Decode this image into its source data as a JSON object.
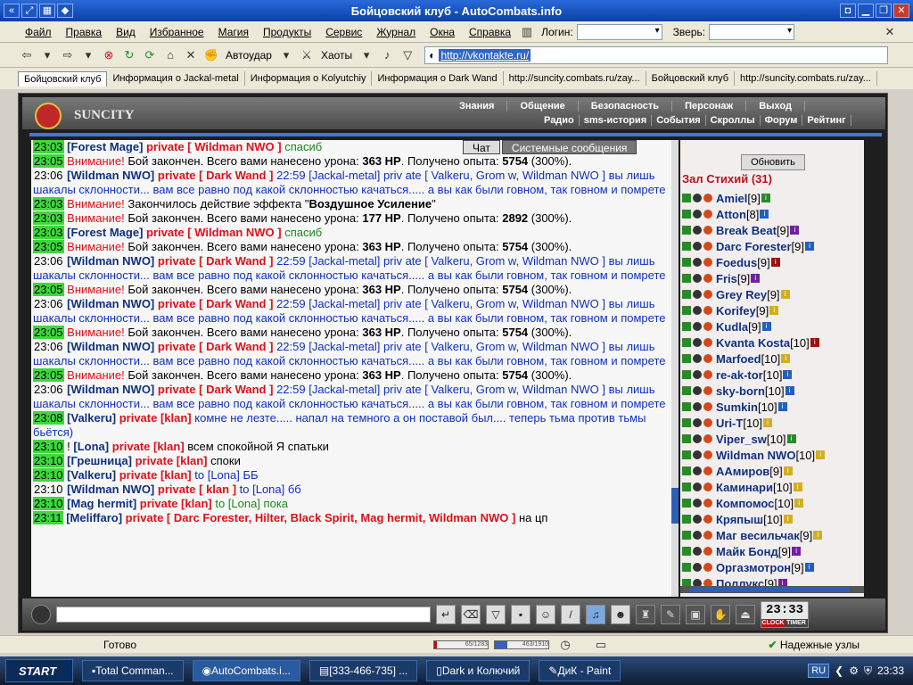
{
  "window": {
    "title": "Бойцовский клуб - AutoCombats.info"
  },
  "menu": {
    "items": [
      "Файл",
      "Правка",
      "Вид",
      "Избранное",
      "Магия",
      "Продукты",
      "Сервис",
      "Журнал",
      "Окна",
      "Справка"
    ],
    "login_label": "Логин:",
    "beast_label": "Зверь:"
  },
  "toolbar": {
    "autoudar": "Автоудар",
    "haoty": "Хаоты",
    "url": "http://vkontakte.ru/"
  },
  "tabs": [
    "Бойцовский клуб",
    "Информация о Jackal-metal",
    "Информация о Kolyutchiy",
    "Информация о Dark Wand",
    "http://suncity.combats.ru/zay...",
    "Бойцовский клуб",
    "http://suncity.combats.ru/zay..."
  ],
  "game": {
    "city": "SUNCITY",
    "nav": [
      "Знания",
      "Общение",
      "Безопасность",
      "Персонаж",
      "Выход"
    ],
    "subnav": [
      "Радио",
      "sms-история",
      "События",
      "Скроллы",
      "Форум",
      "Рейтинг"
    ],
    "chat_tabs": [
      "Чат",
      "Системные сообщения"
    ],
    "update_btn": "Обновить",
    "hall": "Зал Стихий (31)",
    "clock": "23:33",
    "clock_labels": [
      "CLOCK",
      "TIMER"
    ]
  },
  "chat": [
    {
      "t": "23:03",
      "name": "Forest Mage",
      "priv": "private [ Wildman NWO ]",
      "msg": "спасиб",
      "kind": "green"
    },
    {
      "t": "23:05",
      "warn": "Внимание!",
      "text": "Бой закончен. Всего вами нанесено урона: ",
      "b1": "363 HP",
      "text2": ". Получено опыта: ",
      "b2": "5754",
      "text3": " (300%)."
    },
    {
      "t": "23:06",
      "plain": true,
      "name": "Wildman NWO",
      "priv": "private [ Dark Wand ]",
      "msg": "22:59 [Jackal-metal] priv ate [ Valkeru, Grom w, Wildman NWO ] вы лишь шакалы склонности... вам все равно под какой склонностью качаться..... а вы как были говном, так говном и помрете",
      "kind": "blue"
    },
    {
      "t": "23:03",
      "warn": "Внимание!",
      "text": "Закончилось действие эффекта \"",
      "b1": "Воздушное Усиление",
      "text2": "\"",
      "b2": "",
      "text3": ""
    },
    {
      "t": "23:03",
      "warn": "Внимание!",
      "text": "Бой закончен. Всего вами нанесено урона: ",
      "b1": "177 HP",
      "text2": ". Получено опыта: ",
      "b2": "2892",
      "text3": " (300%)."
    },
    {
      "t": "23:03",
      "name": "Forest Mage",
      "priv": "private [ Wildman NWO ]",
      "msg": "спасиб",
      "kind": "green"
    },
    {
      "t": "23:05",
      "warn": "Внимание!",
      "text": "Бой закончен. Всего вами нанесено урона: ",
      "b1": "363 HP",
      "text2": ". Получено опыта: ",
      "b2": "5754",
      "text3": " (300%)."
    },
    {
      "t": "23:06",
      "plain": true,
      "name": "Wildman NWO",
      "priv": "private [ Dark Wand ]",
      "msg": "22:59 [Jackal-metal] priv ate [ Valkeru, Grom w, Wildman NWO ] вы лишь шакалы склонности... вам все равно под какой склонностью качаться..... а вы как были говном, так говном и помрете",
      "kind": "blue"
    },
    {
      "t": "23:05",
      "warn": "Внимание!",
      "text": "Бой закончен. Всего вами нанесено урона: ",
      "b1": "363 HP",
      "text2": ". Получено опыта: ",
      "b2": "5754",
      "text3": " (300%)."
    },
    {
      "t": "23:06",
      "plain": true,
      "name": "Wildman NWO",
      "priv": "private [ Dark Wand ]",
      "msg": "22:59 [Jackal-metal] priv ate [ Valkeru, Grom w, Wildman NWO ] вы лишь шакалы склонности... вам все равно под какой склонностью качаться..... а вы как были говном, так говном и помрете",
      "kind": "blue"
    },
    {
      "t": "23:05",
      "warn": "Внимание!",
      "text": "Бой закончен. Всего вами нанесено урона: ",
      "b1": "363 HP",
      "text2": ". Получено опыта: ",
      "b2": "5754",
      "text3": " (300%)."
    },
    {
      "t": "23:06",
      "plain": true,
      "name": "Wildman NWO",
      "priv": "private [ Dark Wand ]",
      "msg": "22:59 [Jackal-metal] priv ate [ Valkeru, Grom w, Wildman NWO ] вы лишь шакалы склонности... вам все равно под какой склонностью качаться..... а вы как были говном, так говном и помрете",
      "kind": "blue"
    },
    {
      "t": "23:05",
      "warn": "Внимание!",
      "text": "Бой закончен. Всего вами нанесено урона: ",
      "b1": "363 HP",
      "text2": ". Получено опыта: ",
      "b2": "5754",
      "text3": " (300%)."
    },
    {
      "t": "23:06",
      "plain": true,
      "name": "Wildman NWO",
      "priv": "private [ Dark Wand ]",
      "msg": "22:59 [Jackal-metal] priv ate [ Valkeru, Grom w, Wildman NWO ] вы лишь шакалы склонности... вам все равно под какой склонностью качаться..... а вы как были говном, так говном и помрете",
      "kind": "blue"
    },
    {
      "t": "23:08",
      "name": "Valkeru",
      "priv": "private [klan]",
      "msg": "комне не лезте..... напал на темного а он поставой был.... теперь тьма против тьмы бьётся)",
      "kind": "blue"
    },
    {
      "t": "23:10",
      "pre": "! ",
      "name": "Lona",
      "priv": "private [klan]",
      "msg": "всем спокойной Я спатьки",
      "kind": "black"
    },
    {
      "t": "23:10",
      "name": "Грешница",
      "priv": "private [klan]",
      "msg": "споки",
      "kind": "black"
    },
    {
      "t": "23:10",
      "name": "Valkeru",
      "priv": "private [klan]",
      "msg": "to [Lona] ББ",
      "kind": "blue"
    },
    {
      "t": "23:10",
      "plain": true,
      "name": "Wildman NWO",
      "priv": "private [ klan ]",
      "msg": "to [Lona] бб",
      "kind": "blue"
    },
    {
      "t": "23:10",
      "name": "Mag hermit",
      "priv": "private [klan]",
      "msg": "to [Lona] пока",
      "kind": "green"
    },
    {
      "t": "23:11",
      "name": "Meliffaro",
      "priv": "private [ Darc Forester, Hilter, Black Spirit, Mag hermit, Wildman NWO ]",
      "msg": "на цп",
      "kind": "black"
    }
  ],
  "users": [
    {
      "name": "Amiel",
      "lvl": "[9]",
      "info": "g"
    },
    {
      "name": "Atton",
      "lvl": "[8]",
      "info": "b"
    },
    {
      "name": "Break Beat",
      "lvl": "[9]",
      "info": "p"
    },
    {
      "name": "Darc Forester",
      "lvl": "[9]",
      "info": "b"
    },
    {
      "name": "Foedus",
      "lvl": "[9]",
      "info": "r"
    },
    {
      "name": "Fris",
      "lvl": "[9]",
      "info": "p"
    },
    {
      "name": "Grey Rey",
      "lvl": "[9]",
      "info": "y"
    },
    {
      "name": "Korifey",
      "lvl": "[9]",
      "info": "y"
    },
    {
      "name": "Kudla",
      "lvl": "[9]",
      "info": "b"
    },
    {
      "name": "Kvanta Kosta",
      "lvl": "[10]",
      "info": "r"
    },
    {
      "name": "Marfoed",
      "lvl": "[10]",
      "info": "y"
    },
    {
      "name": "re-ak-tor",
      "lvl": "[10]",
      "info": "b"
    },
    {
      "name": "sky-born",
      "lvl": "[10]",
      "info": "b"
    },
    {
      "name": "Sumkin",
      "lvl": "[10]",
      "info": "b"
    },
    {
      "name": "Uri-T",
      "lvl": "[10]",
      "info": "y"
    },
    {
      "name": "Viper_sw",
      "lvl": "[10]",
      "info": "g"
    },
    {
      "name": "Wildman NWO",
      "lvl": "[10]",
      "info": "y"
    },
    {
      "name": "AAмиров",
      "lvl": "[9]",
      "info": "y"
    },
    {
      "name": "Каминари",
      "lvl": "[10]",
      "info": "y"
    },
    {
      "name": "Компомос",
      "lvl": "[10]",
      "info": "y"
    },
    {
      "name": "Кряпыш",
      "lvl": "[10]",
      "info": "y"
    },
    {
      "name": "Маг весильчак",
      "lvl": "[9]",
      "info": "y"
    },
    {
      "name": "Майк Бонд",
      "lvl": "[9]",
      "info": "p"
    },
    {
      "name": "Оргазмотрон",
      "lvl": "[9]",
      "info": "b"
    },
    {
      "name": "Поллукс",
      "lvl": "[9]",
      "info": "p"
    }
  ],
  "status": {
    "ready": "Готово",
    "bar1": "65/1283",
    "bar2": "463/1910",
    "bar1_fraction": 0.05,
    "bar2_fraction": 0.24,
    "safe": "Надежные узлы"
  },
  "taskbar": {
    "start": "START",
    "tasks": [
      "Total Comman...",
      "AutoCombats.i...",
      "[333-466-735] ...",
      "Dark и Колючий",
      "ДиК - Paint"
    ],
    "lang": "RU",
    "time": "23:33"
  }
}
